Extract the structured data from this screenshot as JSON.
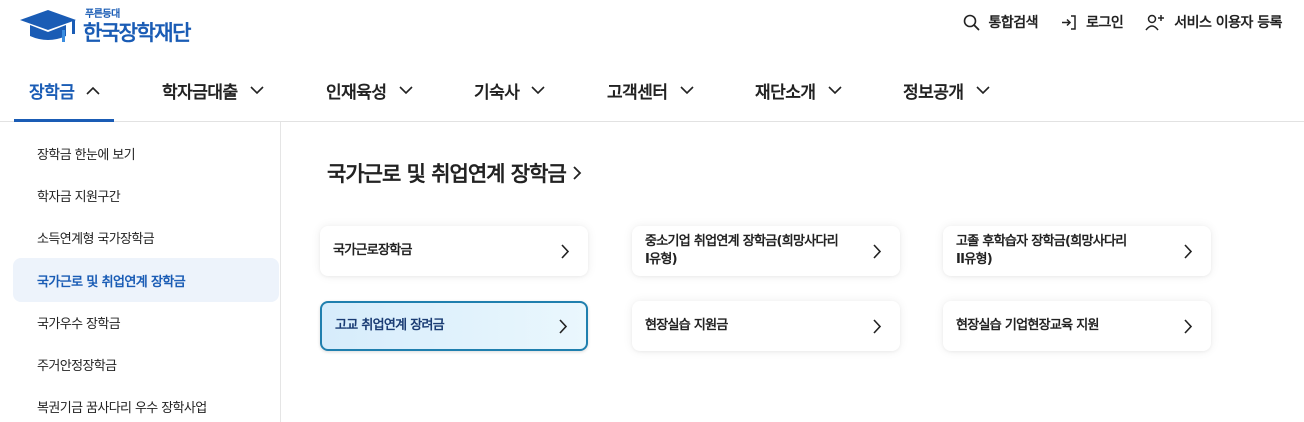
{
  "header": {
    "logo_sub": "푸른등대",
    "logo_text": "한국장학재단",
    "util": [
      {
        "label": "통합검색",
        "icon": "search-icon"
      },
      {
        "label": "로그인",
        "icon": "login-icon"
      },
      {
        "label": "서비스 이용자 등록",
        "icon": "user-add-icon"
      }
    ]
  },
  "gnb": {
    "items": [
      {
        "label": "장학금",
        "active": true,
        "chevron": "up"
      },
      {
        "label": "학자금대출",
        "chevron": "down"
      },
      {
        "label": "인재육성",
        "chevron": "down"
      },
      {
        "label": "기숙사",
        "chevron": "down"
      },
      {
        "label": "고객센터",
        "chevron": "down"
      },
      {
        "label": "재단소개",
        "chevron": "down"
      },
      {
        "label": "정보공개",
        "chevron": "down"
      }
    ]
  },
  "sidebar": {
    "items": [
      {
        "label": "장학금 한눈에 보기"
      },
      {
        "label": "학자금 지원구간"
      },
      {
        "label": "소득연계형 국가장학금"
      },
      {
        "label": "국가근로 및 취업연계 장학금",
        "active": true
      },
      {
        "label": "국가우수 장학금"
      },
      {
        "label": "주거안정장학금"
      },
      {
        "label": "복권기금 꿈사다리 우수 장학사업"
      }
    ]
  },
  "main": {
    "title": "국가근로 및 취업연계 장학금",
    "cards": [
      {
        "label": "국가근로장학금"
      },
      {
        "label_line1": "중소기업 취업연계 장학금(희망사다리",
        "label_line2": "I유형)"
      },
      {
        "label_line1": "고졸 후학습자 장학금(희망사다리",
        "label_line2": "II유형)"
      },
      {
        "label": "고교 취업연계 장려금",
        "active": true
      },
      {
        "label": "현장실습 지원금"
      },
      {
        "label": "현장실습 기업현장교육 지원"
      }
    ]
  },
  "colors": {
    "brand": "#1a5cb5",
    "active_card_border": "#1f7fae",
    "sidebar_active_bg": "#edf3fb"
  }
}
